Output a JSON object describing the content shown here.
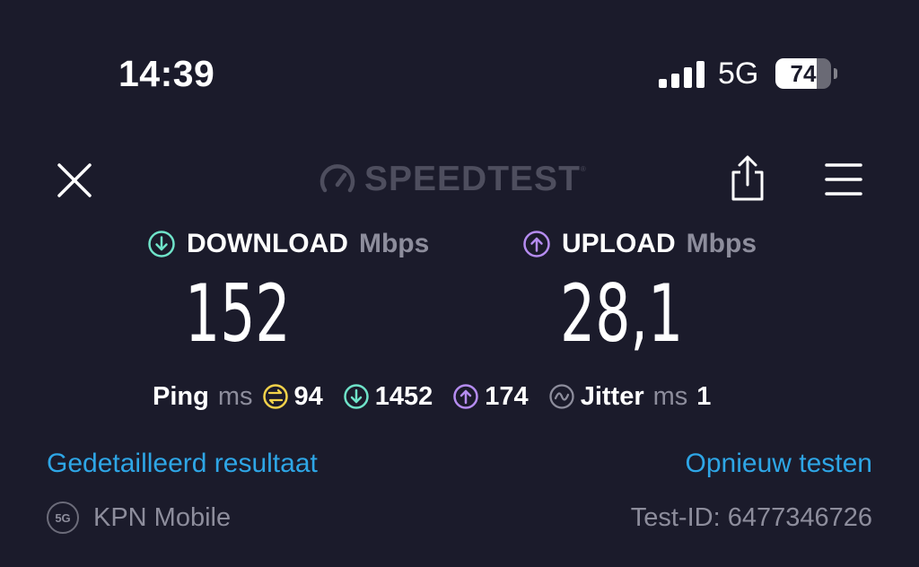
{
  "status_bar": {
    "time": "14:39",
    "network": "5G",
    "battery_level": "74",
    "battery_percent": 74
  },
  "header": {
    "logo_text": "SPEEDTEST",
    "trademark": "®"
  },
  "download": {
    "label": "DOWNLOAD",
    "unit": "Mbps",
    "value": "152",
    "color": "#6fe3c9"
  },
  "upload": {
    "label": "UPLOAD",
    "unit": "Mbps",
    "value": "28,1",
    "color": "#b58cf0"
  },
  "stats": {
    "ping_label": "Ping",
    "ping_unit": "ms",
    "idle_ping": "94",
    "download_ping": "1452",
    "upload_ping": "174",
    "jitter_label": "Jitter",
    "jitter_unit": "ms",
    "jitter_value": "1",
    "idle_color": "#f2d24a"
  },
  "links": {
    "detailed_result": "Gedetailleerd resultaat",
    "retest": "Opnieuw testen"
  },
  "footer": {
    "provider_badge": "5G",
    "provider_name": "KPN Mobile",
    "test_id": "Test-ID: 6477346726"
  },
  "colors": {
    "background": "#1b1b2b",
    "link": "#2ea6e6",
    "muted": "#8d8d9c"
  }
}
